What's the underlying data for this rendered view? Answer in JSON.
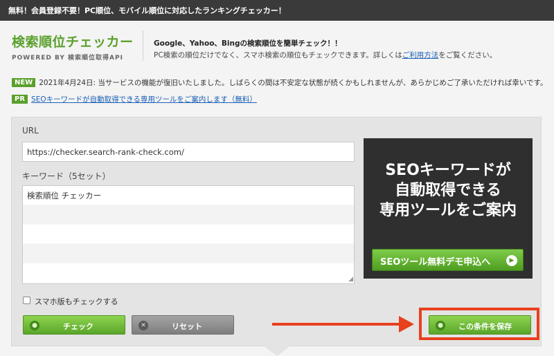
{
  "top_bar": {
    "text": "無料！会員登録不要！PC順位、モバイル順位に対応したランキングチェッカー！"
  },
  "header": {
    "logo_title": "検索順位チェッカー",
    "logo_sub": "POWERED BY 検索順位取得API",
    "tagline": "Google、Yahoo、Bingの検索順位を簡単チェック！！",
    "desc_before": "PC検索の順位だけでなく、スマホ検索の順位もチェックできます。詳しくは",
    "desc_link": "ご利用方法",
    "desc_after": "をご覧ください。"
  },
  "notices": [
    {
      "badge": "NEW",
      "text": "2021年4月24日: 当サービスの機能が復旧いたしました。しばらくの間は不安定な状態が続くかもしれませんが、あらかじめご了承いただければ幸いです。"
    },
    {
      "badge": "PR",
      "link": "SEOキーワードが自動取得できる専用ツールをご案内します（無料）"
    }
  ],
  "form": {
    "url_label": "URL",
    "url_value": "https://checker.search-rank-check.com/",
    "keyword_label": "キーワード（5セット）",
    "keywords": [
      "検索順位 チェッカー",
      "",
      "",
      "",
      ""
    ],
    "mobile_checkbox_label": "スマホ版もチェックする",
    "mobile_checked": false,
    "check_button": "チェック",
    "reset_button": "リセット",
    "save_button": "この条件を保存"
  },
  "ad": {
    "lines": [
      "SEOキーワードが",
      "自動取得できる",
      "専用ツールをご案内"
    ],
    "button": "SEOツール無料デモ申込へ"
  },
  "colors": {
    "brand_green": "#5aa02c",
    "highlight": "#e8401c",
    "top_bar": "#3a3a3a",
    "ad_bg": "#2f2f2f"
  }
}
